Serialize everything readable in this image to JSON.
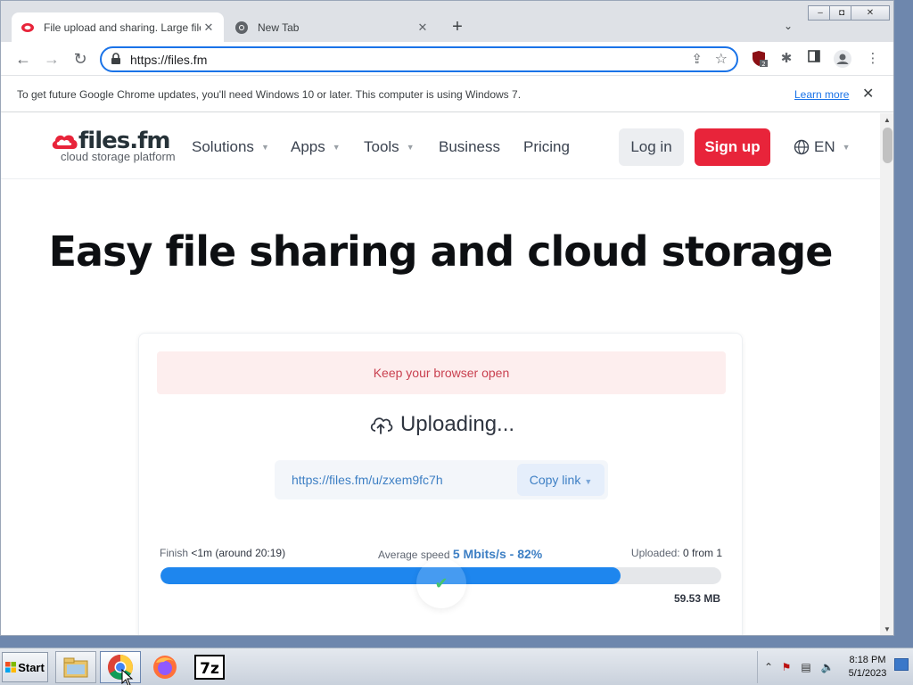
{
  "browser": {
    "tabs": [
      {
        "title": "File upload and sharing. Large file transfer",
        "active": true
      },
      {
        "title": "New Tab",
        "active": false
      }
    ],
    "address": "https://files.fm",
    "infobar": {
      "message": "To get future Google Chrome updates, you'll need Windows 10 or later. This computer is using Windows 7.",
      "link": "Learn more"
    },
    "extension_badge": "2"
  },
  "site": {
    "logo": {
      "name": "files.fm",
      "tagline": "cloud storage platform"
    },
    "nav": [
      "Solutions",
      "Apps",
      "Tools",
      "Business",
      "Pricing"
    ],
    "login_label": "Log in",
    "signup_label": "Sign up",
    "language": "EN",
    "hero_title": "Easy file sharing and cloud storage"
  },
  "upload": {
    "notice": "Keep your browser open",
    "status": "Uploading...",
    "link": "https://files.fm/u/zxem9fc7h",
    "copy_label": "Copy link",
    "finish_label": "Finish",
    "finish_value": "<1m (around 20:19)",
    "speed_label": "Average speed",
    "speed_value": "5 Mbits/s - 82%",
    "uploaded_label": "Uploaded:",
    "uploaded_value": "0 from 1",
    "progress_fraction": 0.82,
    "size": "59.53 MB"
  },
  "taskbar": {
    "start_label": "Start",
    "time": "8:18 PM",
    "date": "5/1/2023"
  },
  "colors": {
    "accent_blue": "#1e86ee",
    "signup_red": "#e8243a",
    "link_blue": "#3d7fc4",
    "notice_bg": "#fdeeee"
  }
}
